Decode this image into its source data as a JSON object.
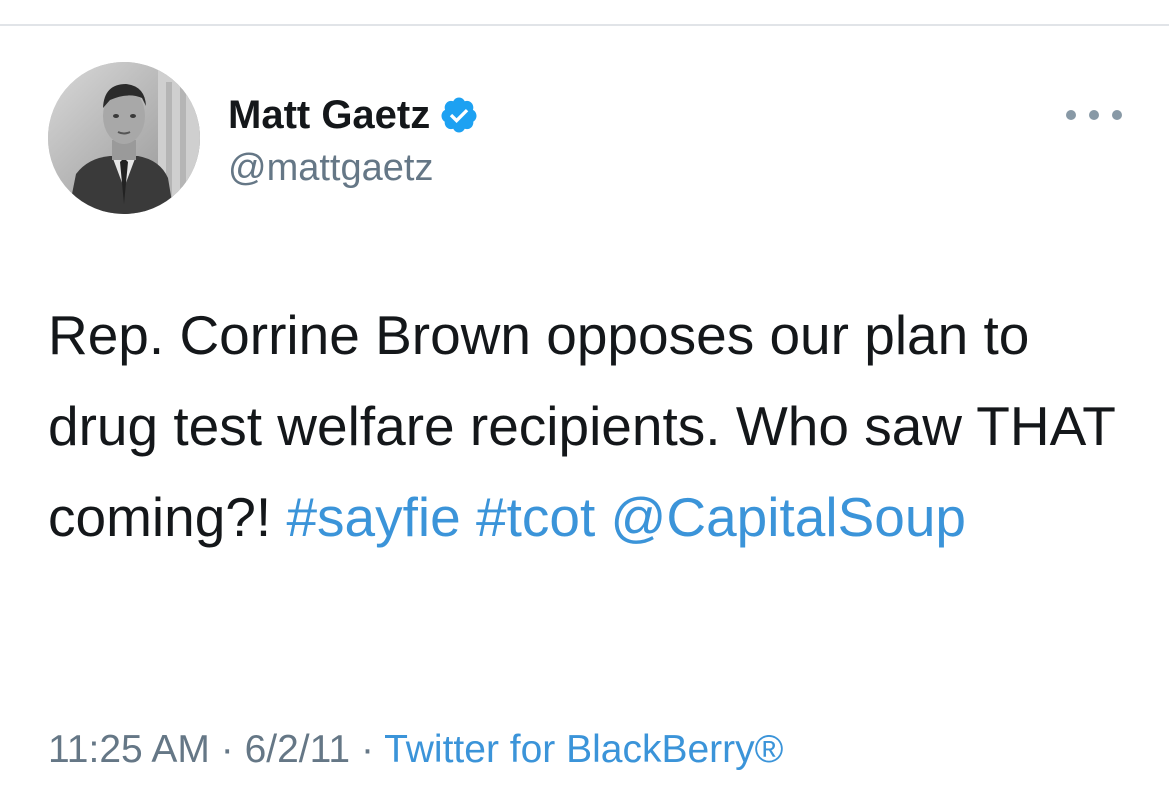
{
  "author": {
    "name": "Matt Gaetz",
    "handle": "@mattgaetz",
    "verified": true,
    "avatar_icon": "profile-photo",
    "verified_icon": "verified-badge-icon"
  },
  "tweet": {
    "text_plain": "Rep. Corrine Brown opposes our plan to drug test welfare recipients. Who saw THAT coming?! ",
    "hashtag_1": "#sayfie",
    "hashtag_2": "#tcot",
    "mention": "@CapitalSoup"
  },
  "meta": {
    "time": "11:25 AM",
    "separator": " · ",
    "date": "6/2/11",
    "source": "Twitter for BlackBerry®"
  },
  "more_icon": "more-dots-icon",
  "colors": {
    "link": "#3b94d9",
    "secondary_text": "#657786",
    "primary_text": "#14171a",
    "verified": "#1da1f2"
  }
}
